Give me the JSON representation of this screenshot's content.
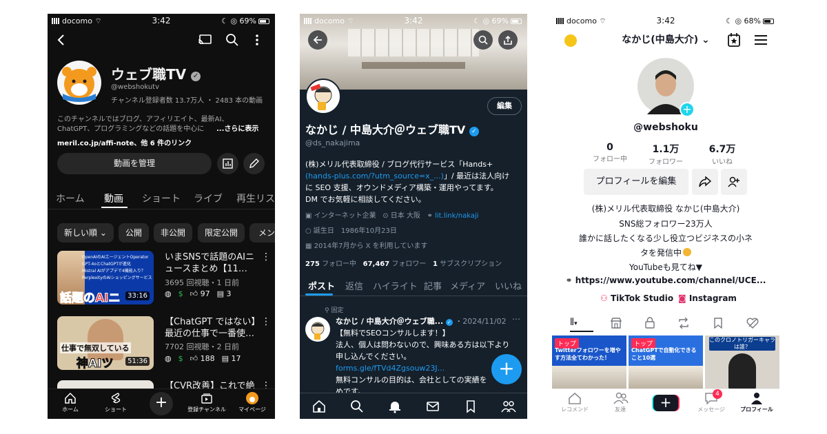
{
  "youtube": {
    "status": {
      "carrier": "docomo",
      "time": "3:42",
      "battery": "69%"
    },
    "channel_name": "ウェブ職TV",
    "handle": "@webshokutv",
    "stats": "チャンネル登録者数 13.7万人 ・ 2483 本の動画",
    "description_1": "このチャンネルではブログ、アフィリエイト、最新AI、",
    "description_2": "ChatGPT、プログラミングなどの話題を中心に",
    "more": "...さらに表示",
    "links": "meril.co.jp/affi-note、他 6 件のリンク",
    "manage_button": "動画を管理",
    "tabs": [
      "ホーム",
      "動画",
      "ショート",
      "ライブ",
      "再生リス"
    ],
    "filters": [
      "新しい順",
      "公開",
      "非公開",
      "限定公開",
      "メン"
    ],
    "videos": [
      {
        "title": "いまSNSで話題のAIニュースまとめ【11…",
        "meta": "3695 回視聴・1 日前",
        "duration": "33:16",
        "likes": "97",
        "comments": "3",
        "thumb_lines": [
          "OpenAIのAIエージェントOperator",
          "GPT-4oとChatGPTが進化",
          "Mistral AIがアプデで4機能入り？",
          "PerplexityのAIショッピングサービス"
        ],
        "thumb_big": "話題のAIニ"
      },
      {
        "title": "【ChatGPT ではない】最近の仕事で一番使…",
        "meta": "7702 回視聴・2 日前",
        "duration": "51:36",
        "likes": "188",
        "comments": "17",
        "thumb_big_1": "仕事で無双している",
        "thumb_big_2": "神AIツ"
      },
      {
        "title": "【CVR改善】これで絶"
      }
    ],
    "nav": [
      "ホーム",
      "ショート",
      "",
      "登録チャンネル",
      "マイページ"
    ]
  },
  "x": {
    "status": {
      "carrier": "docomo",
      "time": "3:42",
      "battery": "69%"
    },
    "edit_button": "編集",
    "name": "なかじ / 中島大介＠ウェブ職TV",
    "handle": "@ds_nakajima",
    "bio_1": "(株)メリル代表取締役 / ブログ代行サービス「Hands+",
    "bio_link": "(hands-plus.com/?utm_source=x_...)",
    "bio_2": "」/ 最近は法人向け",
    "bio_3": "に SEO 支援、オウンドメディア構築・運用やってます。",
    "bio_4": "DM でお気軽に相談してください。",
    "category": "インターネット企業",
    "location": "日本 大阪",
    "link": "lit.link/nakaji",
    "birthday": "誕生日　1986年10月23日",
    "joined": "2014年7月から X を利用しています",
    "following_count": "275",
    "following_label": "フォロー中",
    "followers_count": "67,467",
    "followers_label": "フォロワー",
    "subs_count": "1",
    "subs_label": "サブスクリプション",
    "tabs": [
      "ポスト",
      "返信",
      "ハイライト",
      "記事",
      "メディア",
      "いいね"
    ],
    "pinned_label": "固定",
    "post_name": "なかじ / 中島大介＠ウェブ職...",
    "post_date": "・2024/11/02",
    "post_1": "【無料でSEOコンサルします！】",
    "post_2": "法人、個人は問わないので、興味ある方は以下より",
    "post_3": "申し込んでください。",
    "post_link": "forms.gle/fTVd4Zgsouw23J...",
    "post_4": "無料コンサルの目的は、会社としての実績を",
    "post_5": "めです。"
  },
  "tiktok": {
    "status": {
      "carrier": "docomo",
      "time": "3:42",
      "battery": "68%"
    },
    "display_name": "なかじ(中島大介)",
    "username": "@webshoku",
    "stats": [
      {
        "value": "0",
        "label": "フォロー中"
      },
      {
        "value": "1.1万",
        "label": "フォロワー"
      },
      {
        "value": "6.7万",
        "label": "いいね"
      }
    ],
    "edit_button": "プロフィールを編集",
    "bio": [
      "(株)メリル代表取締役 なかじ(中島大介)",
      "SNS総フォロワー23万人",
      "誰かに話したくなる少し役立つビジネスの小ネ",
      "タを発信中",
      "YouTubeも見てね▼"
    ],
    "link": "https://www.youtube.com/channel/UCE...",
    "tiktok_studio": "TikTok Studio",
    "instagram": "Instagram",
    "grid": [
      {
        "badge": "トップ",
        "caption": "Twitterフォロワーを増やす方法全てわかった！"
      },
      {
        "badge": "トップ",
        "caption": "ChatGPTで自動化できること10選"
      },
      {
        "caption": "このクロノトリガーキャラは誰？"
      }
    ],
    "nav": [
      "レコメンド",
      "友達",
      "",
      "メッセージ",
      "プロフィール"
    ],
    "message_badge": "4"
  },
  "colors": {
    "youtube_bg": "#0f0f0f",
    "x_bg": "#15202b",
    "x_blue": "#1d9bf0",
    "tiktok_red": "#fe2c55",
    "tiktok_cyan": "#25f4ee"
  }
}
